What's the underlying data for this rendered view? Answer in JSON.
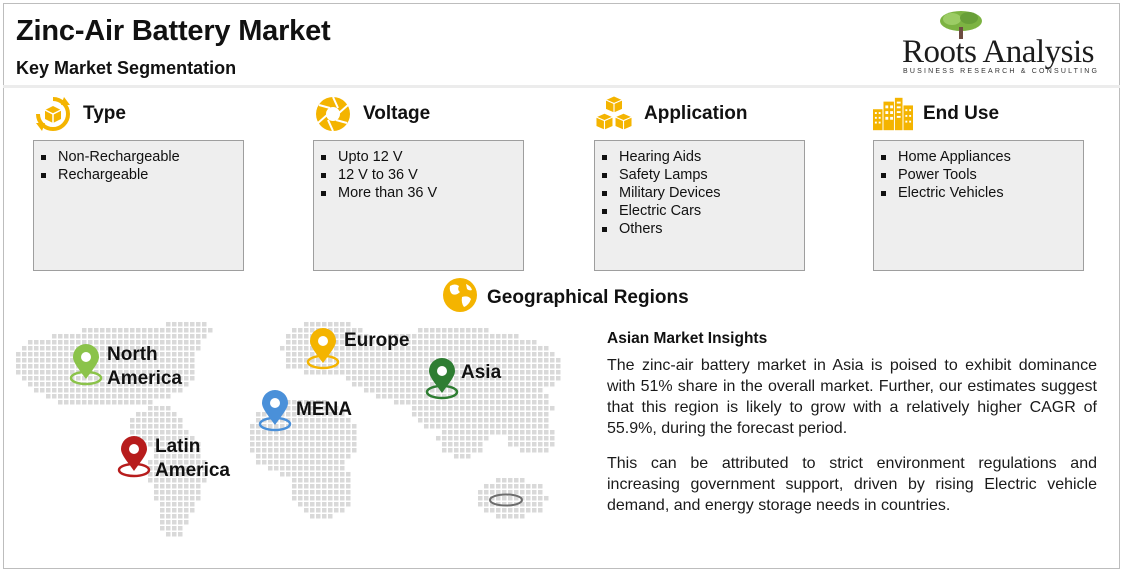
{
  "header": {
    "title": "Zinc-Air Battery Market",
    "subtitle": "Key Market Segmentation"
  },
  "logo": {
    "name": "Roots Analysis",
    "tagline": "BUSINESS RESEARCH & CONSULTING"
  },
  "segments": [
    {
      "title": "Type",
      "icon": "recycle-cube-icon",
      "items": [
        "Non-Rechargeable",
        "Rechargeable"
      ]
    },
    {
      "title": "Voltage",
      "icon": "aperture-icon",
      "items": [
        "Upto 12 V",
        "12 V to 36 V",
        "More than 36 V"
      ]
    },
    {
      "title": "Application",
      "icon": "boxes-icon",
      "items": [
        "Hearing Aids",
        "Safety Lamps",
        "Military Devices",
        "Electric Cars",
        "Others"
      ]
    },
    {
      "title": "End Use",
      "icon": "buildings-icon",
      "items": [
        "Home Appliances",
        "Power Tools",
        "Electric Vehicles"
      ]
    }
  ],
  "geography": {
    "title": "Geographical Regions",
    "icon": "globe-icon",
    "regions": [
      {
        "label_line1": "North",
        "label_line2": "America",
        "color": "#8bc34a"
      },
      {
        "label_line1": "Europe",
        "label_line2": "",
        "color": "#f4b400"
      },
      {
        "label_line1": "Asia",
        "label_line2": "",
        "color": "#2e7d32"
      },
      {
        "label_line1": "MENA",
        "label_line2": "",
        "color": "#4a90d9"
      },
      {
        "label_line1": "Latin",
        "label_line2": "America",
        "color": "#b71c1c"
      }
    ]
  },
  "insights": {
    "title": "Asian Market Insights",
    "paragraph1": "The zinc-air battery market in Asia is poised to exhibit dominance with 51% share in the overall market. Further, our estimates suggest that this region is likely to grow with a relatively higher CAGR of 55.9%, during the forecast period.",
    "paragraph2": "This can be attributed to strict environment regulations and increasing government support, driven by rising Electric vehicle demand, and  energy storage needs in countries."
  },
  "colors": {
    "accent_yellow": "#f4b400",
    "box_fill": "#eeeeee",
    "box_border": "#9e9e9e"
  }
}
